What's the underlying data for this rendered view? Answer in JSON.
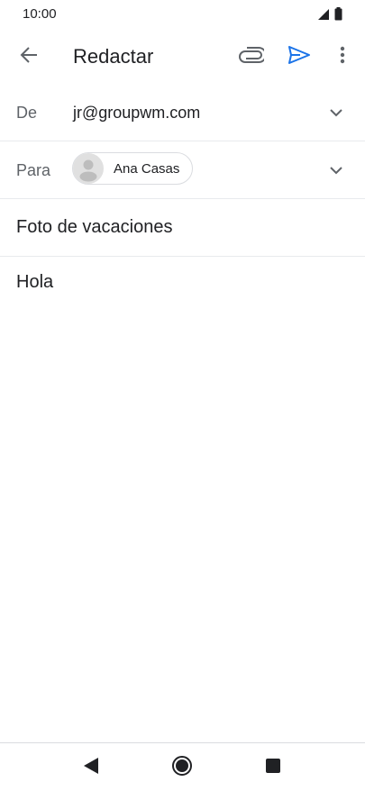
{
  "status_bar": {
    "time": "10:00",
    "icons": [
      "signal-icon",
      "battery-icon"
    ]
  },
  "app_bar": {
    "title": "Redactar",
    "icons": {
      "back": "arrow-back-icon",
      "attach": "paperclip-icon",
      "send": "send-icon",
      "more": "more-vert-icon"
    },
    "accent_color": "#1a73e8"
  },
  "compose": {
    "from_label": "De",
    "from_value": "jr@groupwm.com",
    "to_label": "Para",
    "recipients": [
      {
        "name": "Ana Casas",
        "avatar_icon": "person-icon"
      }
    ],
    "subject": "Foto de vacaciones",
    "body": "Hola"
  },
  "nav_bar": {
    "icons": [
      "nav-back-icon",
      "nav-home-icon",
      "nav-recents-icon"
    ]
  }
}
